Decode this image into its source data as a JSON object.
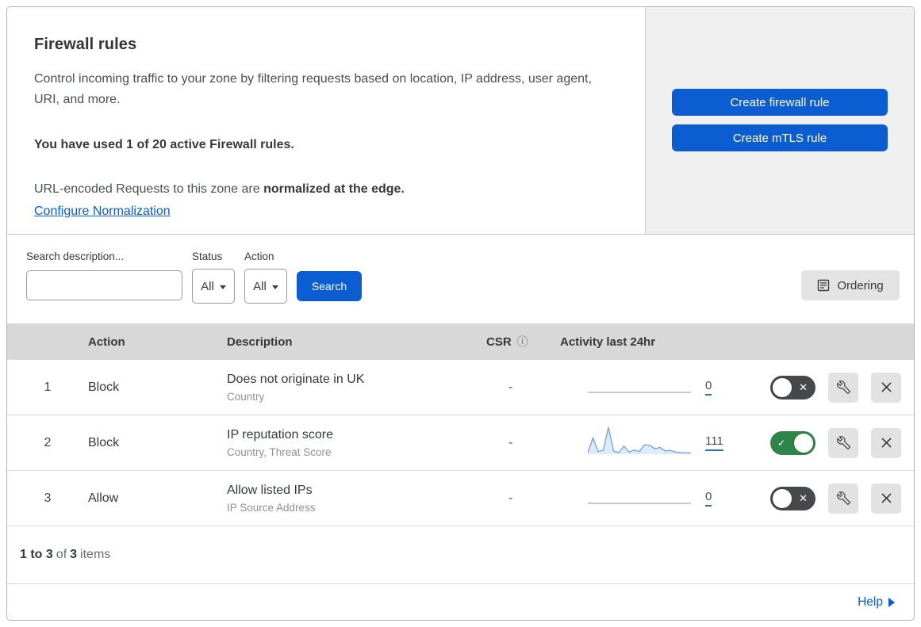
{
  "header": {
    "title": "Firewall rules",
    "description": "Control incoming traffic to your zone by filtering requests based on location, IP address, user agent, URI, and more.",
    "usage": "You have used 1 of 20 active Firewall rules.",
    "normalization_prefix": "URL-encoded Requests to this zone are ",
    "normalization_bold": "normalized at the edge.",
    "normalization_link": "Configure Normalization",
    "create_firewall_button": "Create firewall rule",
    "create_mtls_button": "Create mTLS rule"
  },
  "filters": {
    "search_label": "Search description...",
    "search_value": "",
    "status_label": "Status",
    "status_value": "All",
    "action_label": "Action",
    "action_value": "All",
    "search_button": "Search",
    "ordering_button": "Ordering"
  },
  "table": {
    "headers": {
      "action": "Action",
      "description": "Description",
      "csr": "CSR",
      "csr_info_icon": "ⓘ",
      "activity": "Activity last 24hr"
    },
    "rows": [
      {
        "num": "1",
        "action": "Block",
        "title": "Does not originate in UK",
        "subtitle": "Country",
        "csr": "-",
        "activity_count": "0",
        "enabled": false,
        "sparkline": []
      },
      {
        "num": "2",
        "action": "Block",
        "title": "IP reputation score",
        "subtitle": "Country, Threat Score",
        "csr": "-",
        "activity_count": "111",
        "enabled": true,
        "sparkline": [
          5,
          60,
          10,
          15,
          100,
          12,
          6,
          30,
          8,
          15,
          10,
          35,
          33,
          20,
          25,
          12,
          14,
          8,
          6,
          5,
          4
        ]
      },
      {
        "num": "3",
        "action": "Allow",
        "title": "Allow listed IPs",
        "subtitle": "IP Source Address",
        "csr": "-",
        "activity_count": "0",
        "enabled": false,
        "sparkline": []
      }
    ]
  },
  "footer": {
    "range": "1 to 3",
    "of": "of",
    "total": "3",
    "items": "items",
    "help": "Help"
  },
  "toggle_glyphs": {
    "on": "✓",
    "off": "✕"
  },
  "colors": {
    "primary_blue": "#0d5dd2",
    "link_blue": "#0b5bd3",
    "toggle_on_green": "#2e8548",
    "toggle_off_gray": "#47484b",
    "table_header_gray": "#d8d8d8",
    "panel_gray": "#f0f0f1",
    "sparkline_blue": "#7aa4ec"
  }
}
